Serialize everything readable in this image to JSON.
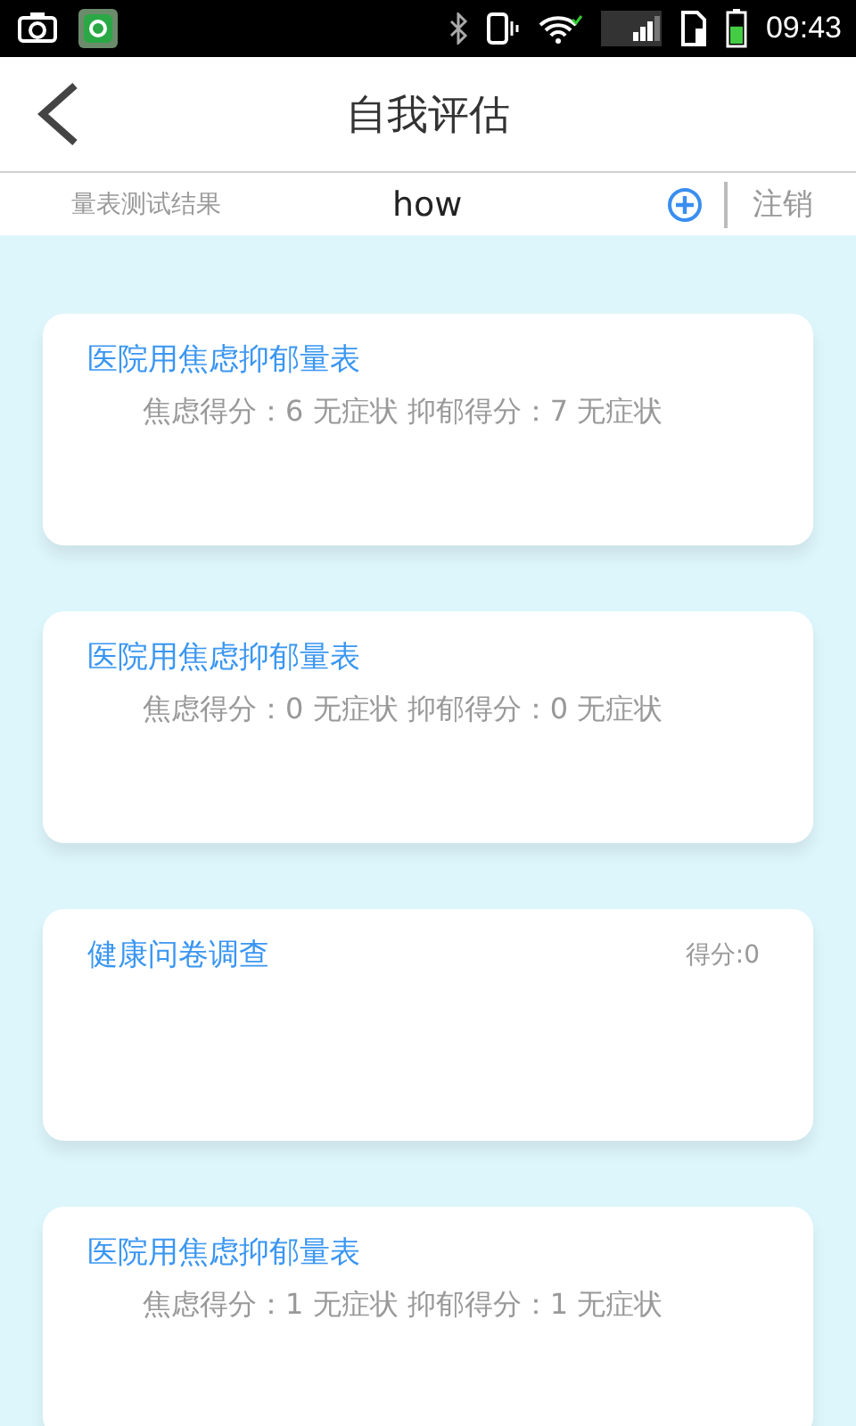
{
  "status_bar": {
    "time": "09:43"
  },
  "header": {
    "title": "自我评估"
  },
  "subbar": {
    "label": "量表测试结果",
    "user": "how",
    "logout": "注销"
  },
  "cards": [
    {
      "kind": "scale",
      "title": "医院用焦虑抑郁量表",
      "result": "焦虑得分：6 无症状 抑郁得分：7 无症状"
    },
    {
      "kind": "scale",
      "title": "医院用焦虑抑郁量表",
      "result": "焦虑得分：0 无症状 抑郁得分：0 无症状"
    },
    {
      "kind": "survey",
      "title": "健康问卷调查",
      "result": "得分:0"
    },
    {
      "kind": "scale",
      "title": "医院用焦虑抑郁量表",
      "result": "焦虑得分：1 无症状 抑郁得分：1 无症状"
    }
  ]
}
